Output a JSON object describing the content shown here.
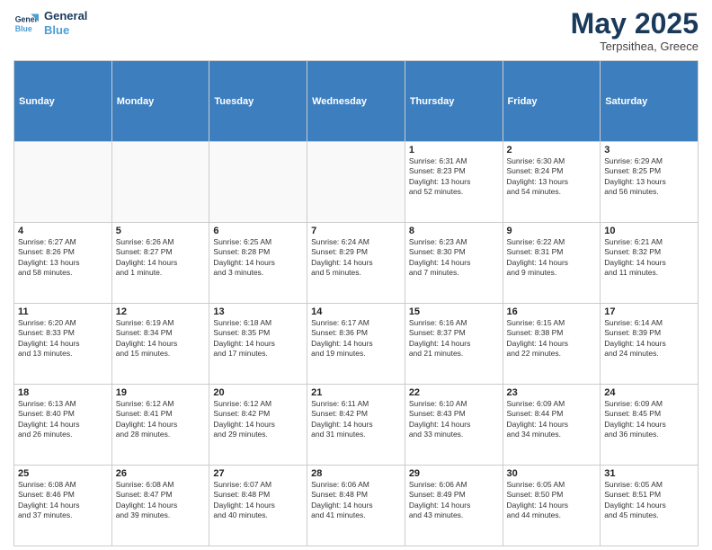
{
  "logo": {
    "line1": "General",
    "line2": "Blue"
  },
  "title": "May 2025",
  "subtitle": "Terpsithea, Greece",
  "days": [
    "Sunday",
    "Monday",
    "Tuesday",
    "Wednesday",
    "Thursday",
    "Friday",
    "Saturday"
  ],
  "weeks": [
    [
      {
        "day": "",
        "text": ""
      },
      {
        "day": "",
        "text": ""
      },
      {
        "day": "",
        "text": ""
      },
      {
        "day": "",
        "text": ""
      },
      {
        "day": "1",
        "text": "Sunrise: 6:31 AM\nSunset: 8:23 PM\nDaylight: 13 hours\nand 52 minutes."
      },
      {
        "day": "2",
        "text": "Sunrise: 6:30 AM\nSunset: 8:24 PM\nDaylight: 13 hours\nand 54 minutes."
      },
      {
        "day": "3",
        "text": "Sunrise: 6:29 AM\nSunset: 8:25 PM\nDaylight: 13 hours\nand 56 minutes."
      }
    ],
    [
      {
        "day": "4",
        "text": "Sunrise: 6:27 AM\nSunset: 8:26 PM\nDaylight: 13 hours\nand 58 minutes."
      },
      {
        "day": "5",
        "text": "Sunrise: 6:26 AM\nSunset: 8:27 PM\nDaylight: 14 hours\nand 1 minute."
      },
      {
        "day": "6",
        "text": "Sunrise: 6:25 AM\nSunset: 8:28 PM\nDaylight: 14 hours\nand 3 minutes."
      },
      {
        "day": "7",
        "text": "Sunrise: 6:24 AM\nSunset: 8:29 PM\nDaylight: 14 hours\nand 5 minutes."
      },
      {
        "day": "8",
        "text": "Sunrise: 6:23 AM\nSunset: 8:30 PM\nDaylight: 14 hours\nand 7 minutes."
      },
      {
        "day": "9",
        "text": "Sunrise: 6:22 AM\nSunset: 8:31 PM\nDaylight: 14 hours\nand 9 minutes."
      },
      {
        "day": "10",
        "text": "Sunrise: 6:21 AM\nSunset: 8:32 PM\nDaylight: 14 hours\nand 11 minutes."
      }
    ],
    [
      {
        "day": "11",
        "text": "Sunrise: 6:20 AM\nSunset: 8:33 PM\nDaylight: 14 hours\nand 13 minutes."
      },
      {
        "day": "12",
        "text": "Sunrise: 6:19 AM\nSunset: 8:34 PM\nDaylight: 14 hours\nand 15 minutes."
      },
      {
        "day": "13",
        "text": "Sunrise: 6:18 AM\nSunset: 8:35 PM\nDaylight: 14 hours\nand 17 minutes."
      },
      {
        "day": "14",
        "text": "Sunrise: 6:17 AM\nSunset: 8:36 PM\nDaylight: 14 hours\nand 19 minutes."
      },
      {
        "day": "15",
        "text": "Sunrise: 6:16 AM\nSunset: 8:37 PM\nDaylight: 14 hours\nand 21 minutes."
      },
      {
        "day": "16",
        "text": "Sunrise: 6:15 AM\nSunset: 8:38 PM\nDaylight: 14 hours\nand 22 minutes."
      },
      {
        "day": "17",
        "text": "Sunrise: 6:14 AM\nSunset: 8:39 PM\nDaylight: 14 hours\nand 24 minutes."
      }
    ],
    [
      {
        "day": "18",
        "text": "Sunrise: 6:13 AM\nSunset: 8:40 PM\nDaylight: 14 hours\nand 26 minutes."
      },
      {
        "day": "19",
        "text": "Sunrise: 6:12 AM\nSunset: 8:41 PM\nDaylight: 14 hours\nand 28 minutes."
      },
      {
        "day": "20",
        "text": "Sunrise: 6:12 AM\nSunset: 8:42 PM\nDaylight: 14 hours\nand 29 minutes."
      },
      {
        "day": "21",
        "text": "Sunrise: 6:11 AM\nSunset: 8:42 PM\nDaylight: 14 hours\nand 31 minutes."
      },
      {
        "day": "22",
        "text": "Sunrise: 6:10 AM\nSunset: 8:43 PM\nDaylight: 14 hours\nand 33 minutes."
      },
      {
        "day": "23",
        "text": "Sunrise: 6:09 AM\nSunset: 8:44 PM\nDaylight: 14 hours\nand 34 minutes."
      },
      {
        "day": "24",
        "text": "Sunrise: 6:09 AM\nSunset: 8:45 PM\nDaylight: 14 hours\nand 36 minutes."
      }
    ],
    [
      {
        "day": "25",
        "text": "Sunrise: 6:08 AM\nSunset: 8:46 PM\nDaylight: 14 hours\nand 37 minutes."
      },
      {
        "day": "26",
        "text": "Sunrise: 6:08 AM\nSunset: 8:47 PM\nDaylight: 14 hours\nand 39 minutes."
      },
      {
        "day": "27",
        "text": "Sunrise: 6:07 AM\nSunset: 8:48 PM\nDaylight: 14 hours\nand 40 minutes."
      },
      {
        "day": "28",
        "text": "Sunrise: 6:06 AM\nSunset: 8:48 PM\nDaylight: 14 hours\nand 41 minutes."
      },
      {
        "day": "29",
        "text": "Sunrise: 6:06 AM\nSunset: 8:49 PM\nDaylight: 14 hours\nand 43 minutes."
      },
      {
        "day": "30",
        "text": "Sunrise: 6:05 AM\nSunset: 8:50 PM\nDaylight: 14 hours\nand 44 minutes."
      },
      {
        "day": "31",
        "text": "Sunrise: 6:05 AM\nSunset: 8:51 PM\nDaylight: 14 hours\nand 45 minutes."
      }
    ]
  ]
}
